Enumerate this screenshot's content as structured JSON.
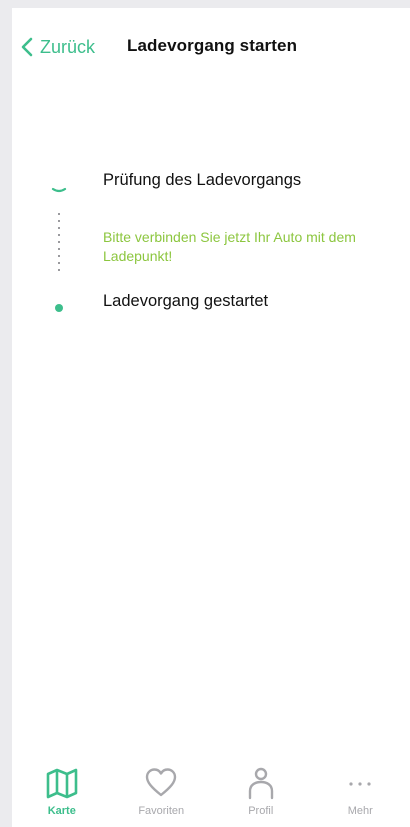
{
  "header": {
    "back_label": "Zurück",
    "title": "Ladevorgang starten"
  },
  "steps": {
    "check": "Prüfung des Ladevorgangs",
    "hint": "Bitte verbinden Sie jetzt Ihr Auto mit dem Ladepunkt!",
    "started": "Ladevorgang gestartet"
  },
  "tabbar": {
    "items": [
      {
        "label": "Karte",
        "icon": "map-icon",
        "active": true
      },
      {
        "label": "Favoriten",
        "icon": "heart-icon",
        "active": false
      },
      {
        "label": "Profil",
        "icon": "user-icon",
        "active": false
      },
      {
        "label": "Mehr",
        "icon": "more-icon",
        "active": false
      }
    ]
  },
  "colors": {
    "accent": "#3dbe8c",
    "hint": "#8cc63f",
    "inactive": "#a8a8ac"
  }
}
